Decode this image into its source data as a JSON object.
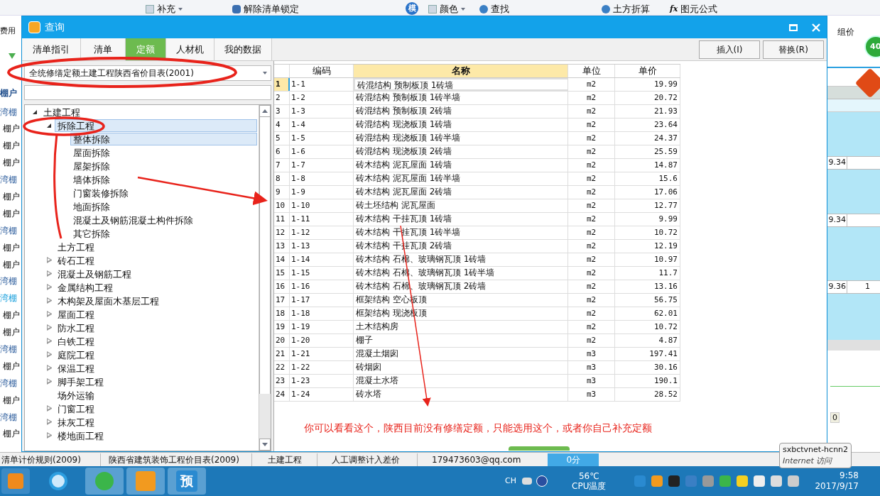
{
  "app_toolbar": {
    "left_label": "费用",
    "right_label": "组价",
    "items": [
      {
        "label": "补充",
        "kind": "dropdown"
      },
      {
        "label": "解除清单锁定",
        "kind": "lock"
      },
      {
        "label": "模",
        "kind": "badge"
      },
      {
        "label": "颜色",
        "kind": "dropdown"
      },
      {
        "label": "查找",
        "kind": "plain"
      },
      {
        "label": "土方折算",
        "kind": "plain"
      },
      {
        "label": "图元公式",
        "kind": "formula",
        "icon_text": "fx"
      }
    ]
  },
  "app_sidebar": {
    "title": "棚户",
    "items": [
      {
        "label": "湾棚",
        "kind": "link"
      },
      {
        "label": "棚户",
        "kind": "plain"
      },
      {
        "label": "棚户",
        "kind": "plain"
      },
      {
        "label": "棚户",
        "kind": "plain"
      },
      {
        "label": "湾棚",
        "kind": "link"
      },
      {
        "label": "棚户",
        "kind": "plain"
      },
      {
        "label": "棚户",
        "kind": "plain"
      },
      {
        "label": "湾棚",
        "kind": "link"
      },
      {
        "label": "棚户",
        "kind": "plain"
      },
      {
        "label": "棚户",
        "kind": "plain"
      },
      {
        "label": "湾棚",
        "kind": "link"
      },
      {
        "label": "湾棚",
        "kind": "active"
      },
      {
        "label": "棚户",
        "kind": "plain"
      },
      {
        "label": "棚户",
        "kind": "plain"
      },
      {
        "label": "湾棚",
        "kind": "link"
      },
      {
        "label": "棚户",
        "kind": "plain"
      },
      {
        "label": "湾棚",
        "kind": "link"
      },
      {
        "label": "棚户",
        "kind": "plain"
      },
      {
        "label": "湾棚",
        "kind": "link"
      },
      {
        "label": "棚户",
        "kind": "plain"
      }
    ]
  },
  "side_grid": {
    "rows": [
      {
        "column_1": "9.34"
      },
      {
        "column_1": "9.34"
      },
      {
        "column_1": "9.36",
        "column_2": "1"
      }
    ],
    "score_badge": "40",
    "footer_value": "0"
  },
  "dialog": {
    "title": "查询",
    "tabs": [
      {
        "label": "清单指引",
        "selected": false
      },
      {
        "label": "清单",
        "selected": false
      },
      {
        "label": "定额",
        "selected": true
      },
      {
        "label": "人材机",
        "selected": false
      },
      {
        "label": "我的数据",
        "selected": false
      }
    ],
    "buttons": [
      "插入(I)",
      "替换(R)"
    ],
    "library": {
      "value": "全统修缮定额土建工程陕西省价目表(2001)"
    },
    "tree": [
      {
        "label": "土建工程",
        "kind": "group",
        "expanded": true,
        "selected": false,
        "children": [
          {
            "label": "拆除工程",
            "kind": "group",
            "expanded": true,
            "selected": true,
            "children": [
              {
                "label": "整体拆除",
                "kind": "leaf",
                "selected": true
              },
              {
                "label": "屋面拆除",
                "kind": "leaf",
                "selected": false
              },
              {
                "label": "屋架拆除",
                "kind": "leaf",
                "selected": false
              },
              {
                "label": "墙体拆除",
                "kind": "leaf",
                "selected": false
              },
              {
                "label": "门窗装修拆除",
                "kind": "leaf",
                "selected": false
              },
              {
                "label": "地面拆除",
                "kind": "leaf",
                "selected": false
              },
              {
                "label": "混凝土及钢筋混凝土构件拆除",
                "kind": "leaf",
                "selected": false
              },
              {
                "label": "其它拆除",
                "kind": "leaf",
                "selected": false
              }
            ]
          },
          {
            "label": "土方工程",
            "kind": "leaf",
            "selected": false
          },
          {
            "label": "砖石工程",
            "kind": "group",
            "expanded": false,
            "selected": false
          },
          {
            "label": "混凝土及钢筋工程",
            "kind": "group",
            "expanded": false,
            "selected": false
          },
          {
            "label": "金属结构工程",
            "kind": "group",
            "expanded": false,
            "selected": false
          },
          {
            "label": "木构架及屋面木基层工程",
            "kind": "group",
            "expanded": false,
            "selected": false
          },
          {
            "label": "屋面工程",
            "kind": "group",
            "expanded": false,
            "selected": false
          },
          {
            "label": "防水工程",
            "kind": "group",
            "expanded": false,
            "selected": false
          },
          {
            "label": "白铁工程",
            "kind": "group",
            "expanded": false,
            "selected": false
          },
          {
            "label": "庭院工程",
            "kind": "group",
            "expanded": false,
            "selected": false
          },
          {
            "label": "保温工程",
            "kind": "group",
            "expanded": false,
            "selected": false
          },
          {
            "label": "脚手架工程",
            "kind": "group",
            "expanded": false,
            "selected": false
          },
          {
            "label": "场外运输",
            "kind": "leaf",
            "selected": false
          },
          {
            "label": "门窗工程",
            "kind": "group",
            "expanded": false,
            "selected": false
          },
          {
            "label": "抹灰工程",
            "kind": "group",
            "expanded": false,
            "selected": false
          },
          {
            "label": "楼地面工程",
            "kind": "group",
            "expanded": false,
            "selected": false
          }
        ]
      }
    ],
    "table": {
      "columns": [
        {
          "label": "编码",
          "selected": false
        },
        {
          "label": "名称",
          "selected": true
        },
        {
          "label": "单位",
          "selected": false
        },
        {
          "label": "单价",
          "selected": false
        }
      ],
      "rows": [
        {
          "index": "1",
          "code": "1-1",
          "name": "砖混结构 预制板顶 1砖墙",
          "unit": "m2",
          "price": "19.99",
          "selected": true
        },
        {
          "index": "2",
          "code": "1-2",
          "name": "砖混结构 预制板顶 1砖半墙",
          "unit": "m2",
          "price": "20.72",
          "selected": false
        },
        {
          "index": "3",
          "code": "1-3",
          "name": "砖混结构 预制板顶 2砖墙",
          "unit": "m2",
          "price": "21.93",
          "selected": false
        },
        {
          "index": "4",
          "code": "1-4",
          "name": "砖混结构 现浇板顶 1砖墙",
          "unit": "m2",
          "price": "23.64",
          "selected": false
        },
        {
          "index": "5",
          "code": "1-5",
          "name": "砖混结构 现浇板顶 1砖半墙",
          "unit": "m2",
          "price": "24.37",
          "selected": false
        },
        {
          "index": "6",
          "code": "1-6",
          "name": "砖混结构 现浇板顶 2砖墙",
          "unit": "m2",
          "price": "25.59",
          "selected": false
        },
        {
          "index": "7",
          "code": "1-7",
          "name": "砖木结构 泥瓦屋面 1砖墙",
          "unit": "m2",
          "price": "14.87",
          "selected": false
        },
        {
          "index": "8",
          "code": "1-8",
          "name": "砖木结构 泥瓦屋面 1砖半墙",
          "unit": "m2",
          "price": "15.6",
          "selected": false
        },
        {
          "index": "9",
          "code": "1-9",
          "name": "砖木结构 泥瓦屋面 2砖墙",
          "unit": "m2",
          "price": "17.06",
          "selected": false
        },
        {
          "index": "10",
          "code": "1-10",
          "name": "砖土坯结构 泥瓦屋面",
          "unit": "m2",
          "price": "12.77",
          "selected": false
        },
        {
          "index": "11",
          "code": "1-11",
          "name": "砖木结构 干挂瓦顶 1砖墙",
          "unit": "m2",
          "price": "9.99",
          "selected": false
        },
        {
          "index": "12",
          "code": "1-12",
          "name": "砖木结构 干挂瓦顶 1砖半墙",
          "unit": "m2",
          "price": "10.72",
          "selected": false
        },
        {
          "index": "13",
          "code": "1-13",
          "name": "砖木结构 干挂瓦顶 2砖墙",
          "unit": "m2",
          "price": "12.19",
          "selected": false
        },
        {
          "index": "14",
          "code": "1-14",
          "name": "砖木结构 石棉、玻璃钢瓦顶 1砖墙",
          "unit": "m2",
          "price": "10.97",
          "selected": false
        },
        {
          "index": "15",
          "code": "1-15",
          "name": "砖木结构 石棉、玻璃钢瓦顶 1砖半墙",
          "unit": "m2",
          "price": "11.7",
          "selected": false
        },
        {
          "index": "16",
          "code": "1-16",
          "name": "砖木结构 石棉、玻璃钢瓦顶 2砖墙",
          "unit": "m2",
          "price": "13.16",
          "selected": false
        },
        {
          "index": "17",
          "code": "1-17",
          "name": "框架结构 空心板顶",
          "unit": "m2",
          "price": "56.75",
          "selected": false
        },
        {
          "index": "18",
          "code": "1-18",
          "name": "框架结构 现浇板顶",
          "unit": "m2",
          "price": "62.01",
          "selected": false
        },
        {
          "index": "19",
          "code": "1-19",
          "name": "土木结构房",
          "unit": "m2",
          "price": "10.72",
          "selected": false
        },
        {
          "index": "20",
          "code": "1-20",
          "name": "棚子",
          "unit": "m2",
          "price": "4.87",
          "selected": false
        },
        {
          "index": "21",
          "code": "1-21",
          "name": "混凝土烟囱",
          "unit": "m3",
          "price": "197.41",
          "selected": false
        },
        {
          "index": "22",
          "code": "1-22",
          "name": "砖烟囱",
          "unit": "m3",
          "price": "30.16",
          "selected": false
        },
        {
          "index": "23",
          "code": "1-23",
          "name": "混凝土水塔",
          "unit": "m3",
          "price": "190.1",
          "selected": false
        },
        {
          "index": "24",
          "code": "1-24",
          "name": "砖水塔",
          "unit": "m3",
          "price": "28.52",
          "selected": false
        }
      ]
    }
  },
  "annotation": {
    "note": "你可以看看这个，陕西目前没有修缮定额，只能选用这个，或者你自己补充定额"
  },
  "status_bar": [
    "清单计价规则(2009)",
    "陕西省建筑装饰工程价目表(2009)",
    "土建工程",
    "人工调整计入差价",
    "179473603@qq.com",
    "0分"
  ],
  "tooltip": {
    "title": "sxbctvnet-hcnn2",
    "subtitle": "Internet 访问"
  },
  "taskbar": {
    "app_label": "预",
    "language": "CH",
    "temperature": "56℃",
    "temperature_label": "CPU温度",
    "time": "9:58",
    "date": "2017/9/17"
  }
}
